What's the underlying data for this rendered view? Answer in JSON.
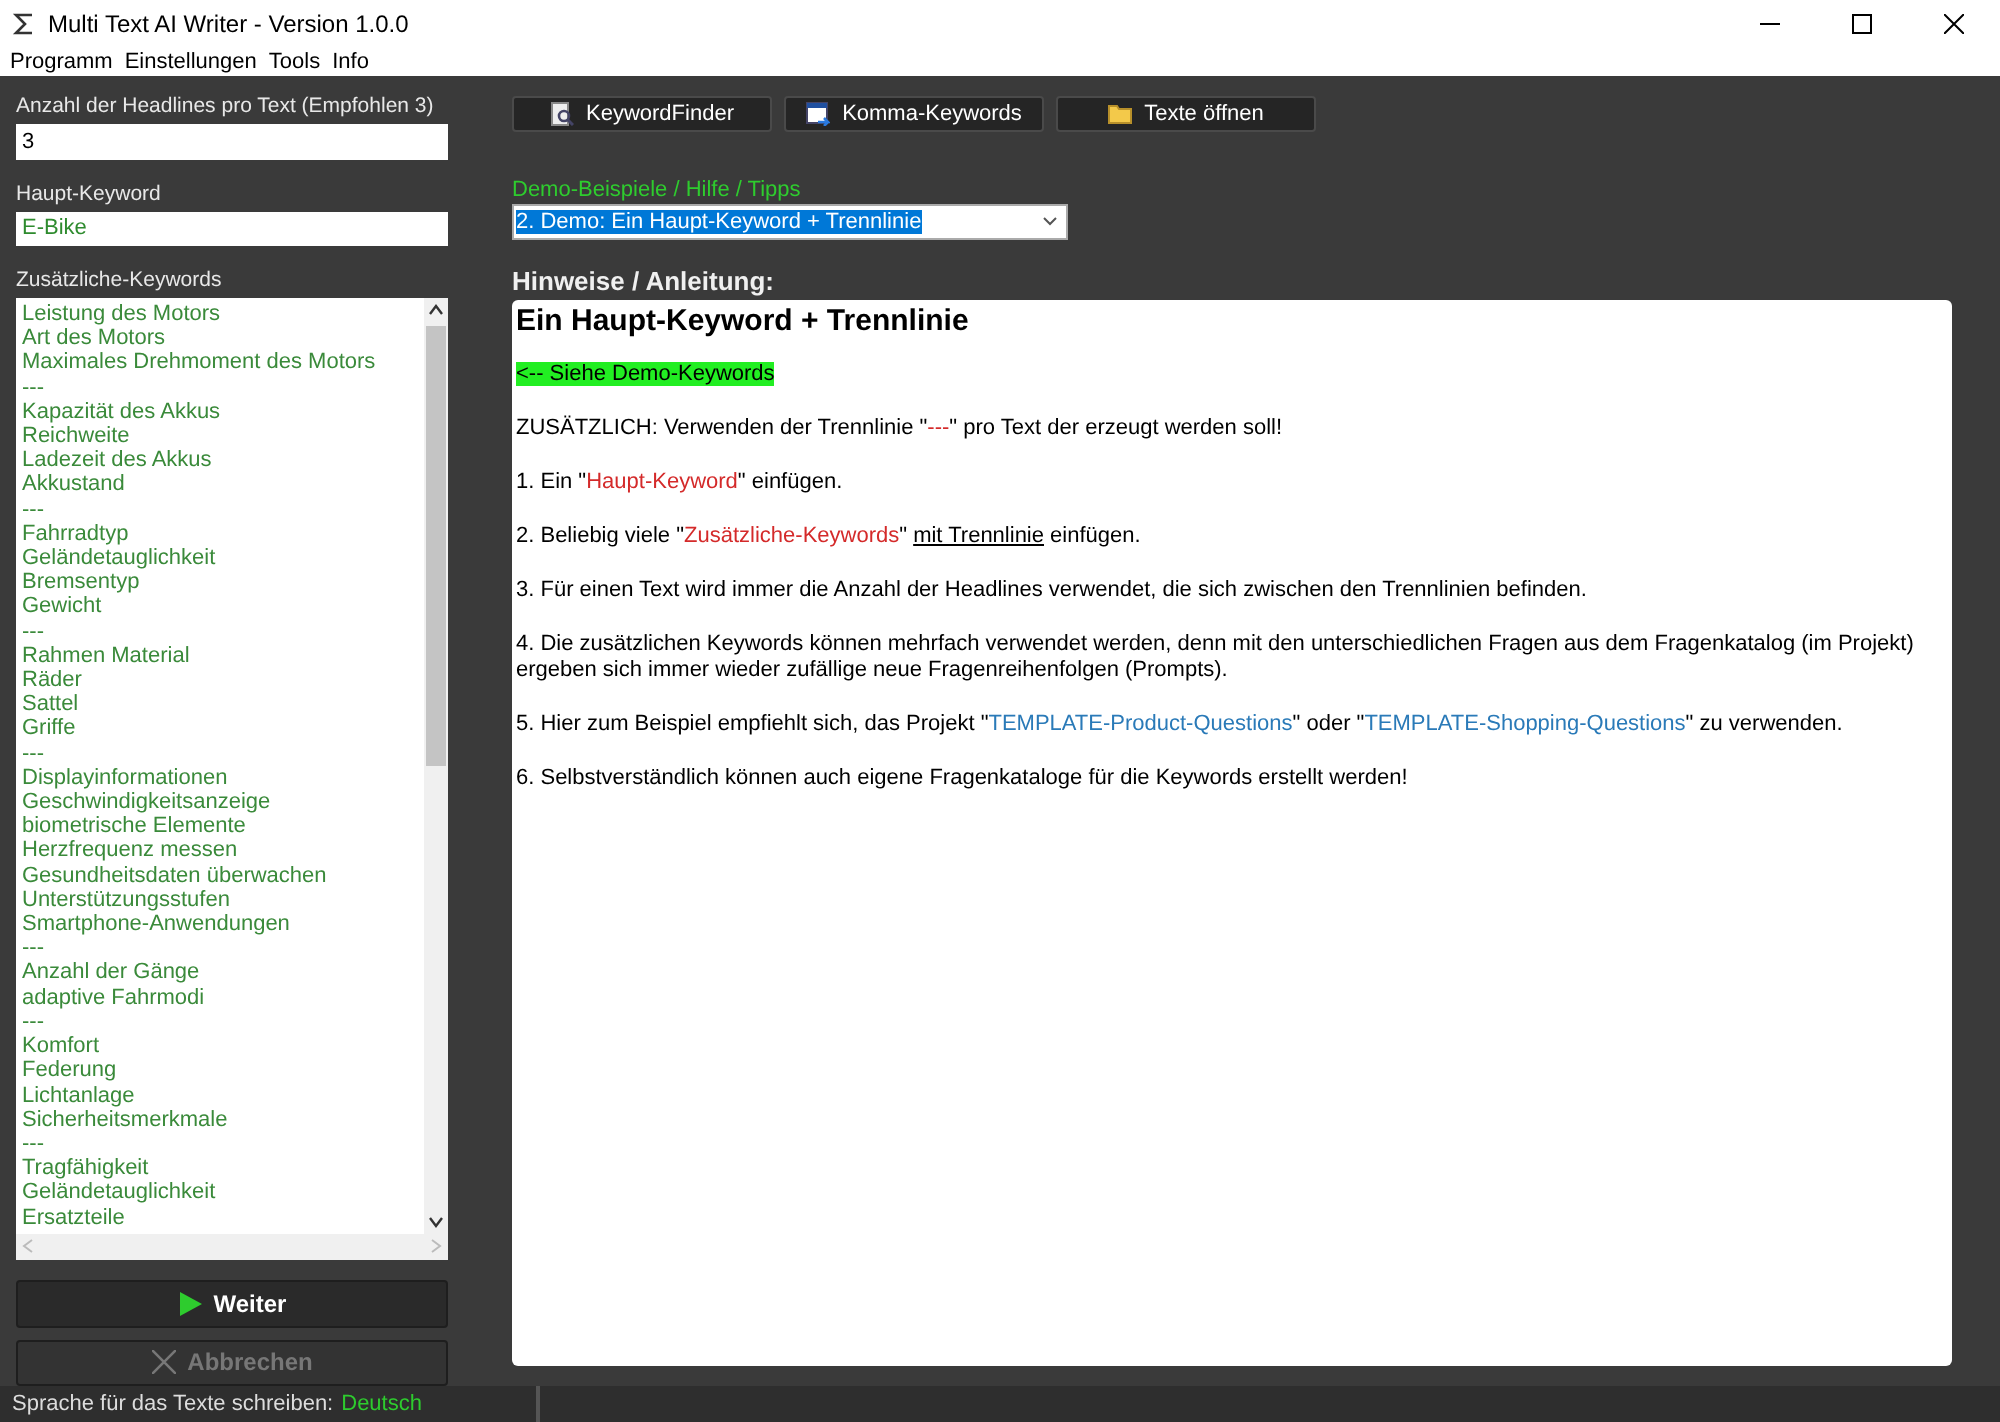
{
  "window": {
    "title": "Multi Text AI Writer - Version 1.0.0"
  },
  "menu": [
    "Programm",
    "Einstellungen",
    "Tools",
    "Info"
  ],
  "left": {
    "headlines_label": "Anzahl der Headlines pro Text (Empfohlen 3)",
    "headlines_value": "3",
    "main_keyword_label": "Haupt-Keyword",
    "main_keyword_value": "E-Bike",
    "keywords_label": "Zusätzliche-Keywords",
    "keywords": [
      "Leistung des Motors",
      "Art des Motors",
      "Maximales Drehmoment des Motors",
      "---",
      "Kapazität des Akkus",
      "Reichweite",
      "Ladezeit des Akkus",
      "Akkustand",
      "---",
      "Fahrradtyp",
      "Geländetauglichkeit",
      "Bremsentyp",
      "Gewicht",
      "---",
      "Rahmen Material",
      "Räder",
      "Sattel",
      "Griffe",
      "---",
      "Displayinformationen",
      "Geschwindigkeitsanzeige",
      "biometrische Elemente",
      "Herzfrequenz messen",
      "Gesundheitsdaten überwachen",
      "Unterstützungsstufen",
      "Smartphone-Anwendungen",
      "---",
      "Anzahl der Gänge",
      "adaptive Fahrmodi",
      "---",
      "Komfort",
      "Federung",
      "Lichtanlage",
      "Sicherheitsmerkmale",
      "---",
      "Tragfähigkeit",
      "Geländetauglichkeit",
      "Ersatzteile"
    ],
    "actions": [
      {
        "label": "Weiter",
        "disabled": false
      },
      {
        "label": "Abbrechen",
        "disabled": true
      }
    ]
  },
  "toolbar": [
    {
      "label": "KeywordFinder"
    },
    {
      "label": "Komma-Keywords"
    },
    {
      "label": "Texte öffnen"
    }
  ],
  "demo": {
    "label": "Demo-Beispiele / Hilfe / Tipps",
    "value": "2. Demo: Ein Haupt-Keyword + Trennlinie"
  },
  "help": {
    "label": "Hinweise / Anleitung:",
    "heading": "Ein Haupt-Keyword + Trennlinie",
    "paragraphs": [
      {
        "segments": [
          {
            "text": "<-- Siehe Demo-Keywords",
            "kind": "highlight"
          }
        ]
      },
      {
        "segments": [
          {
            "text": "ZUSÄTZLICH: Verwenden der Trennlinie \"",
            "kind": "plain"
          },
          {
            "text": "---",
            "kind": "red"
          },
          {
            "text": "\" pro Text der erzeugt werden soll!",
            "kind": "plain"
          }
        ]
      },
      {
        "segments": [
          {
            "text": "1. Ein \"",
            "kind": "plain"
          },
          {
            "text": "Haupt-Keyword",
            "kind": "red"
          },
          {
            "text": "\" einfügen.",
            "kind": "plain"
          }
        ]
      },
      {
        "segments": [
          {
            "text": "2. Beliebig viele \"",
            "kind": "plain"
          },
          {
            "text": "Zusätzliche-Keywords",
            "kind": "red"
          },
          {
            "text": "\" ",
            "kind": "plain"
          },
          {
            "text": "mit Trennlinie",
            "kind": "underline"
          },
          {
            "text": " einfügen.",
            "kind": "plain"
          }
        ]
      },
      {
        "segments": [
          {
            "text": "3. Für einen Text wird immer die Anzahl der Headlines verwendet, die sich zwischen den Trennlinien befinden.",
            "kind": "plain"
          }
        ]
      },
      {
        "segments": [
          {
            "text": "4. Die zusätzlichen Keywords können mehrfach verwendet werden, denn mit den unterschiedlichen Fragen aus dem Fragenkatalog (im Projekt) ergeben sich immer wieder zufällige neue Fragenreihenfolgen (Prompts).",
            "kind": "plain"
          }
        ]
      },
      {
        "segments": [
          {
            "text": "5. Hier zum Beispiel empfiehlt sich, das Projekt \"",
            "kind": "plain"
          },
          {
            "text": "TEMPLATE-Product-Questions",
            "kind": "blue"
          },
          {
            "text": "\" oder \"",
            "kind": "plain"
          },
          {
            "text": "TEMPLATE-Shopping-Questions",
            "kind": "blue"
          },
          {
            "text": "\" zu verwenden.",
            "kind": "plain"
          }
        ]
      },
      {
        "segments": [
          {
            "text": "6. Selbstverständlich können auch eigene Fragenkataloge für die Keywords erstellt werden!",
            "kind": "plain"
          }
        ]
      }
    ]
  },
  "status_bar": {
    "label": "Sprache für das Texte schreiben:",
    "value": "Deutsch"
  }
}
